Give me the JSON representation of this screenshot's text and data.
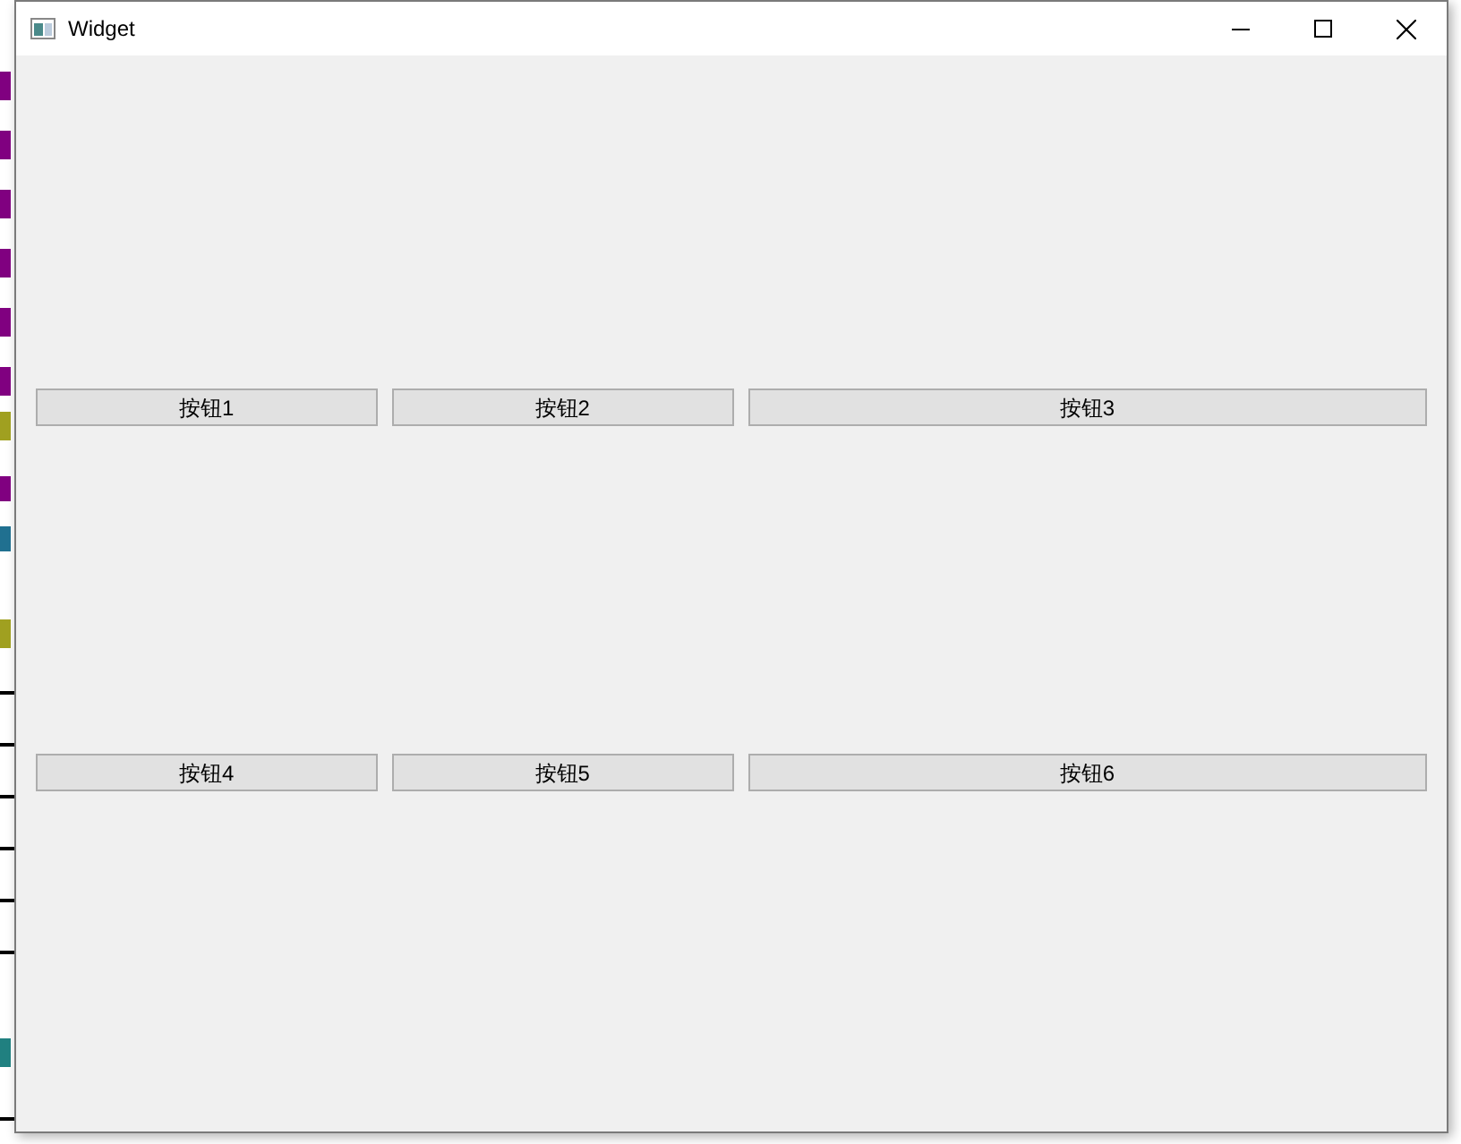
{
  "window": {
    "title": "Widget"
  },
  "button_rows": [
    [
      "按钮1",
      "按钮2",
      "按钮3"
    ],
    [
      "按钮4",
      "按钮5",
      "按钮6"
    ]
  ]
}
